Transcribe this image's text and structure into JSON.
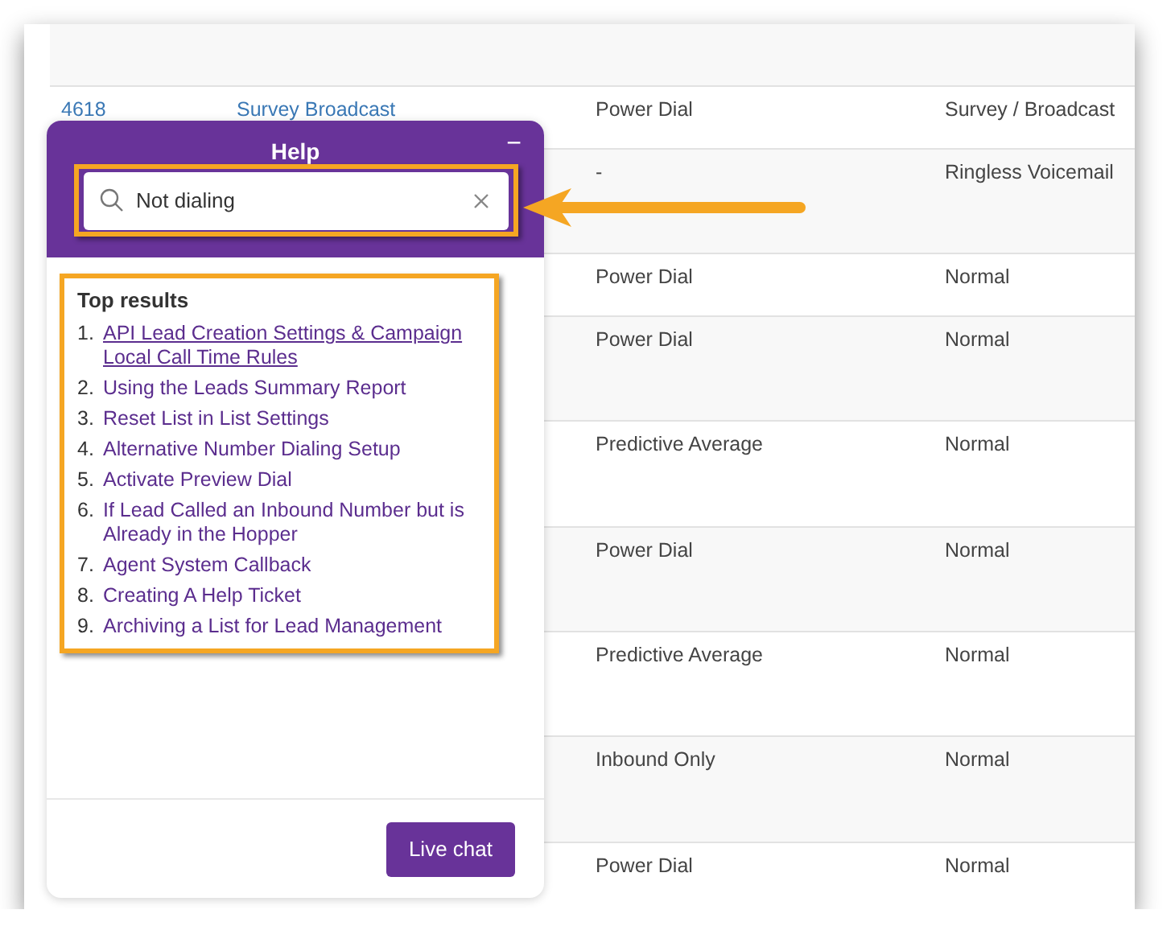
{
  "table": {
    "rows": [
      {
        "id": "4618",
        "campaign": "Survey Broadcast",
        "dial_mode": "Power Dial",
        "type": "Survey / Broadcast"
      },
      {
        "dial_mode": "-",
        "type": "Ringless Voicemail"
      },
      {
        "dial_mode": "Power Dial",
        "type": "Normal"
      },
      {
        "dial_mode": "Power Dial",
        "type": "Normal"
      },
      {
        "dial_mode": "Predictive Average",
        "type": "Normal"
      },
      {
        "dial_mode": "Power Dial",
        "type": "Normal"
      },
      {
        "dial_mode": "Predictive Average",
        "type": "Normal"
      },
      {
        "dial_mode": "Inbound Only",
        "type": "Normal"
      },
      {
        "dial_mode": "Power Dial",
        "type": "Normal"
      }
    ]
  },
  "help": {
    "title": "Help",
    "minimize": "−",
    "search": {
      "value": "Not dialing"
    },
    "results_title": "Top results",
    "results": [
      {
        "number": "1.",
        "title": "API Lead Creation Settings & Campaign Local Call Time Rules",
        "hovered": true
      },
      {
        "number": "2.",
        "title": "Using the Leads Summary Report",
        "hovered": false
      },
      {
        "number": "3.",
        "title": "Reset List in List Settings",
        "hovered": false
      },
      {
        "number": "4.",
        "title": "Alternative Number Dialing Setup",
        "hovered": false
      },
      {
        "number": "5.",
        "title": "Activate Preview Dial",
        "hovered": false
      },
      {
        "number": "6.",
        "title": "If Lead Called an Inbound Number but is Already in the Hopper",
        "hovered": false
      },
      {
        "number": "7.",
        "title": "Agent System Callback",
        "hovered": false
      },
      {
        "number": "8.",
        "title": "Creating A Help Ticket",
        "hovered": false
      },
      {
        "number": "9.",
        "title": "Archiving a List for Lead Management",
        "hovered": false
      }
    ],
    "chat_button": "Live chat"
  }
}
